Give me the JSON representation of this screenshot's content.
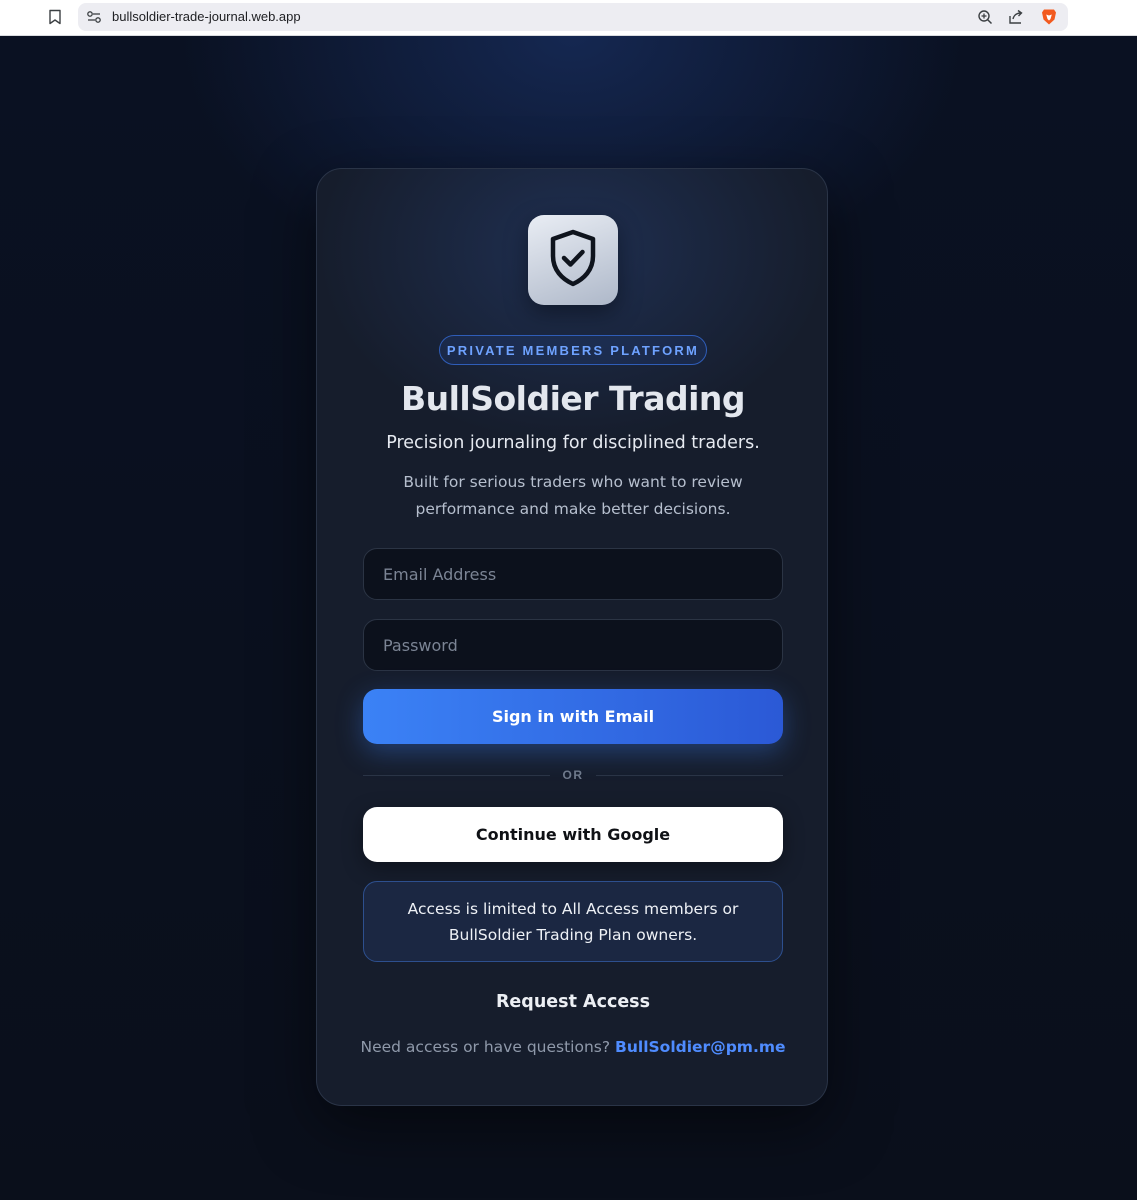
{
  "browser": {
    "url": "bullsoldier-trade-journal.web.app",
    "icons": {
      "bookmark": "bookmark-icon",
      "site_settings": "site-settings-icon",
      "zoom": "zoom-icon",
      "share": "share-icon",
      "brave": "brave-shield-icon"
    }
  },
  "card": {
    "logo_icon": "shield-check-icon",
    "badge": "PRIVATE MEMBERS PLATFORM",
    "title": "BullSoldier Trading",
    "subtitle": "Precision journaling for disciplined traders.",
    "description": "Built for serious traders who want to review performance and make better decisions.",
    "email": {
      "placeholder": "Email Address",
      "value": ""
    },
    "password": {
      "placeholder": "Password",
      "value": ""
    },
    "sign_in_label": "Sign in with Email",
    "divider_label": "OR",
    "google_label": "Continue with Google",
    "notice": "Access is limited to All Access members or BullSoldier Trading Plan owners.",
    "request_heading": "Request Access",
    "contact_text": "Need access or have questions?",
    "contact_email": "BullSoldier@pm.me"
  },
  "colors": {
    "accent": "#3b82f6",
    "link": "#4f8cff",
    "background": "#0b1220",
    "card": "#161d2c"
  }
}
